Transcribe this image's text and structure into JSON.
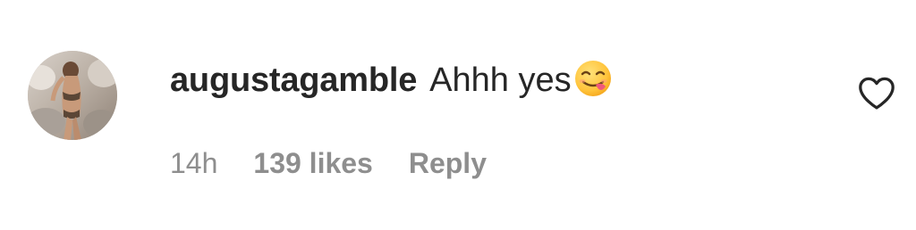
{
  "comment": {
    "username": "augustagamble",
    "text": "Ahhh yes",
    "emoji": "face-savoring-food-emoji",
    "time": "14h",
    "likes": "139 likes",
    "reply_label": "Reply",
    "like_icon": "heart-icon"
  },
  "colors": {
    "primary_text": "#262626",
    "secondary_text": "#8e8e8e",
    "background": "#ffffff"
  }
}
